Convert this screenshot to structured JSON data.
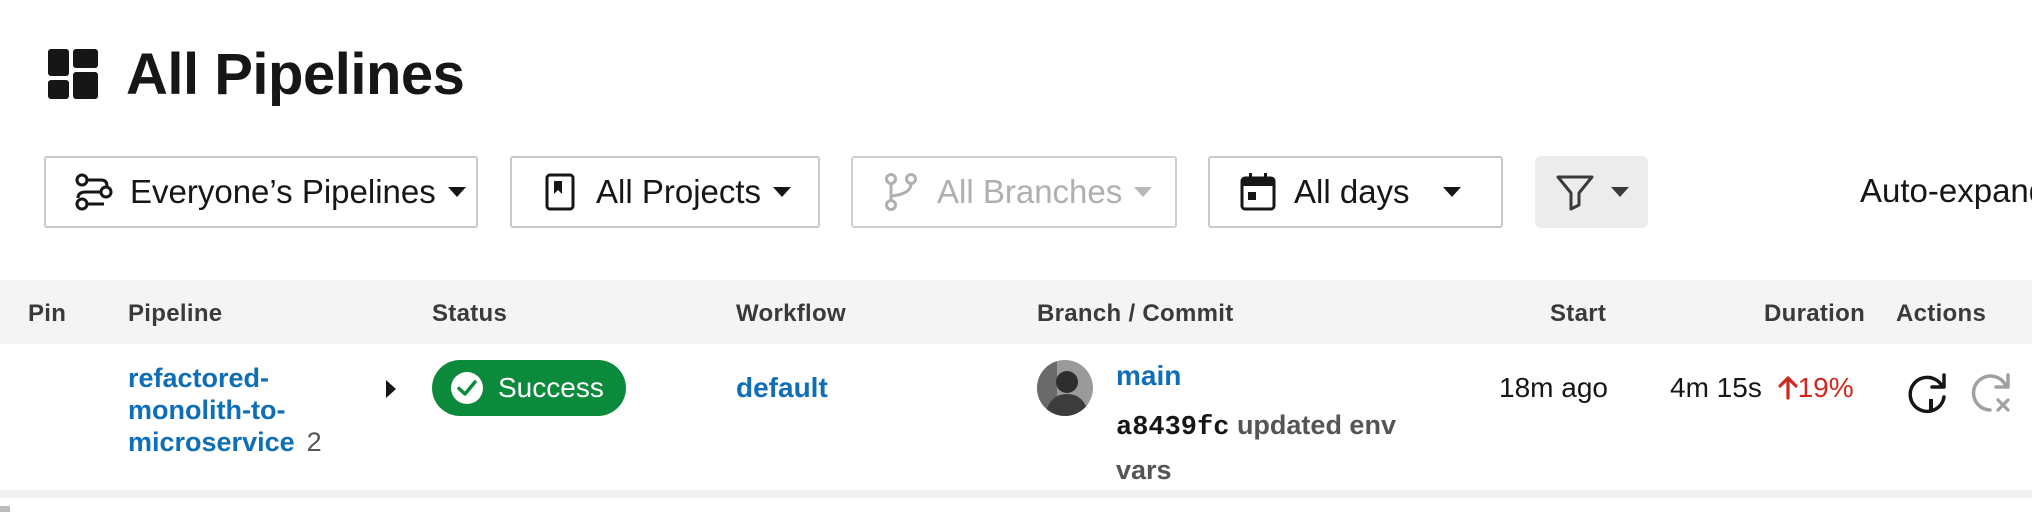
{
  "page": {
    "title": "All Pipelines",
    "title_icon": "dashboard-icon"
  },
  "filters": {
    "people": {
      "label": "Everyone’s Pipelines",
      "icon": "people-network-icon"
    },
    "projects": {
      "label": "All Projects",
      "icon": "bookmark-icon"
    },
    "branches": {
      "label": "All Branches",
      "icon": "git-branch-icon",
      "disabled": true
    },
    "days": {
      "label": "All days",
      "icon": "calendar-icon"
    },
    "filter_button": {
      "icon": "funnel-icon"
    },
    "auto_expand": {
      "label": "Auto-expand"
    }
  },
  "table": {
    "headers": {
      "pin": "Pin",
      "pipeline": "Pipeline",
      "status": "Status",
      "workflow": "Workflow",
      "branch_commit": "Branch / Commit",
      "start": "Start",
      "duration": "Duration",
      "actions": "Actions"
    },
    "rows": [
      {
        "pipeline": "refactored-monolith-to-microservice",
        "pipeline_number": "2",
        "status": "Success",
        "workflow": "default",
        "branch": "main",
        "commit_hash": "a8439fc",
        "commit_message": "updated env vars",
        "start": "18m ago",
        "duration": "4m 15s",
        "duration_change": "19%"
      }
    ]
  },
  "colors": {
    "success": "#0b8a3c",
    "link": "#0e6fb8",
    "increase": "#d0281f",
    "header_bg": "#f4f4f4"
  }
}
